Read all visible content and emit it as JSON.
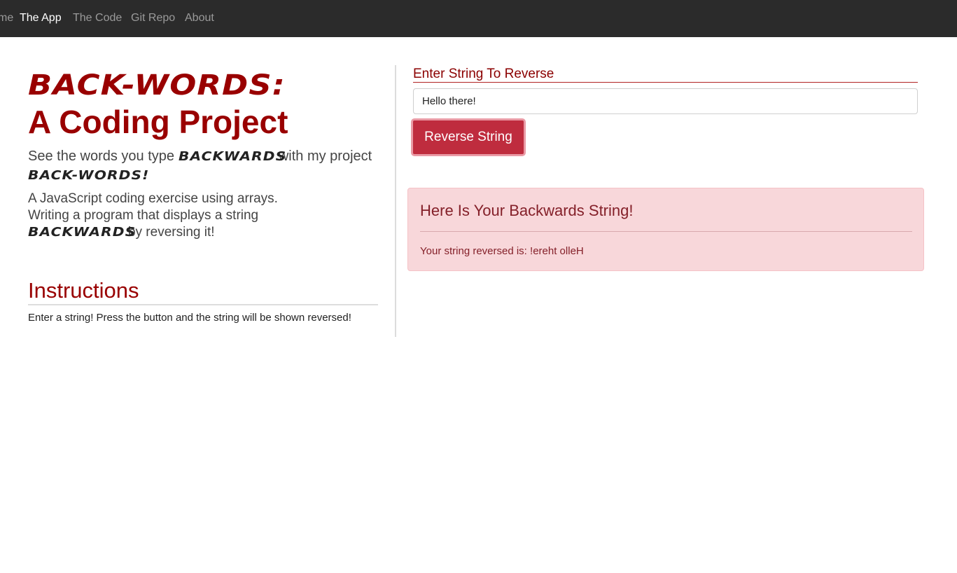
{
  "nav": {
    "items": [
      {
        "label": "Home",
        "visible_label": "me",
        "active": false
      },
      {
        "label": "The App",
        "active": true
      },
      {
        "label": "The Code",
        "active": false
      },
      {
        "label": "Git Repo",
        "active": false
      },
      {
        "label": "About",
        "active": false
      }
    ]
  },
  "intro": {
    "brand_title": "Back-Words:",
    "title": "A Coding Project",
    "lead_part1": "See the words you type ",
    "lead_brand1": "Backwards",
    "lead_part2": " with my project ",
    "lead_brand2": "Back-Words!",
    "desc_line1": "A JavaScript coding exercise using arrays.",
    "desc_line2": "Writing a program that displays a string",
    "desc_brand": "Backwards",
    "desc_line3": " by reversing it!"
  },
  "instructions": {
    "heading": "Instructions",
    "text": "Enter a string! Press the button and the string will be shown reversed!"
  },
  "form": {
    "label": "Enter String To Reverse",
    "input_value": "Hello there!",
    "button_label": "Reverse String"
  },
  "result": {
    "heading": "Here Is Your Backwards String!",
    "prefix": "Your string reversed is: ",
    "value": "!ereht olleH"
  },
  "colors": {
    "navbar_bg": "#2b2b2b",
    "brand_red": "#990000",
    "button_bg": "#bf2c3e",
    "alert_bg": "#f8d7da",
    "alert_text": "#842029"
  }
}
